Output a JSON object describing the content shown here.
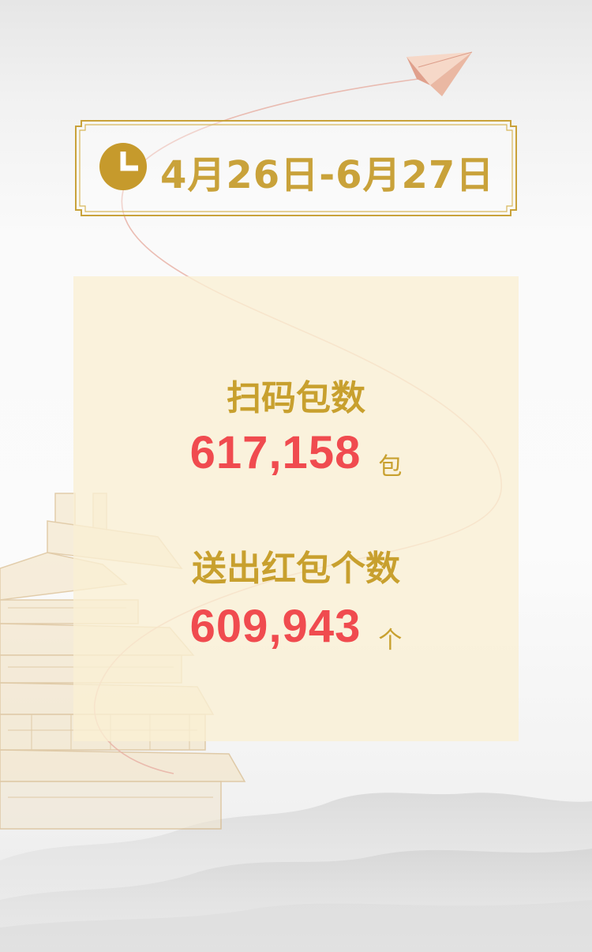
{
  "date_range": "4月26日-6月27日",
  "stats": [
    {
      "label": "扫码包数",
      "value": "617,158",
      "unit": "包"
    },
    {
      "label": "送出红包个数",
      "value": "609,943",
      "unit": "个"
    }
  ],
  "colors": {
    "gold": "#c8a02e",
    "accent_red": "#f04b4f",
    "panel_bg": "#faf0d4",
    "flight_path": "#e8b2a6"
  },
  "icons": [
    "paper-plane-icon",
    "clock-icon"
  ]
}
